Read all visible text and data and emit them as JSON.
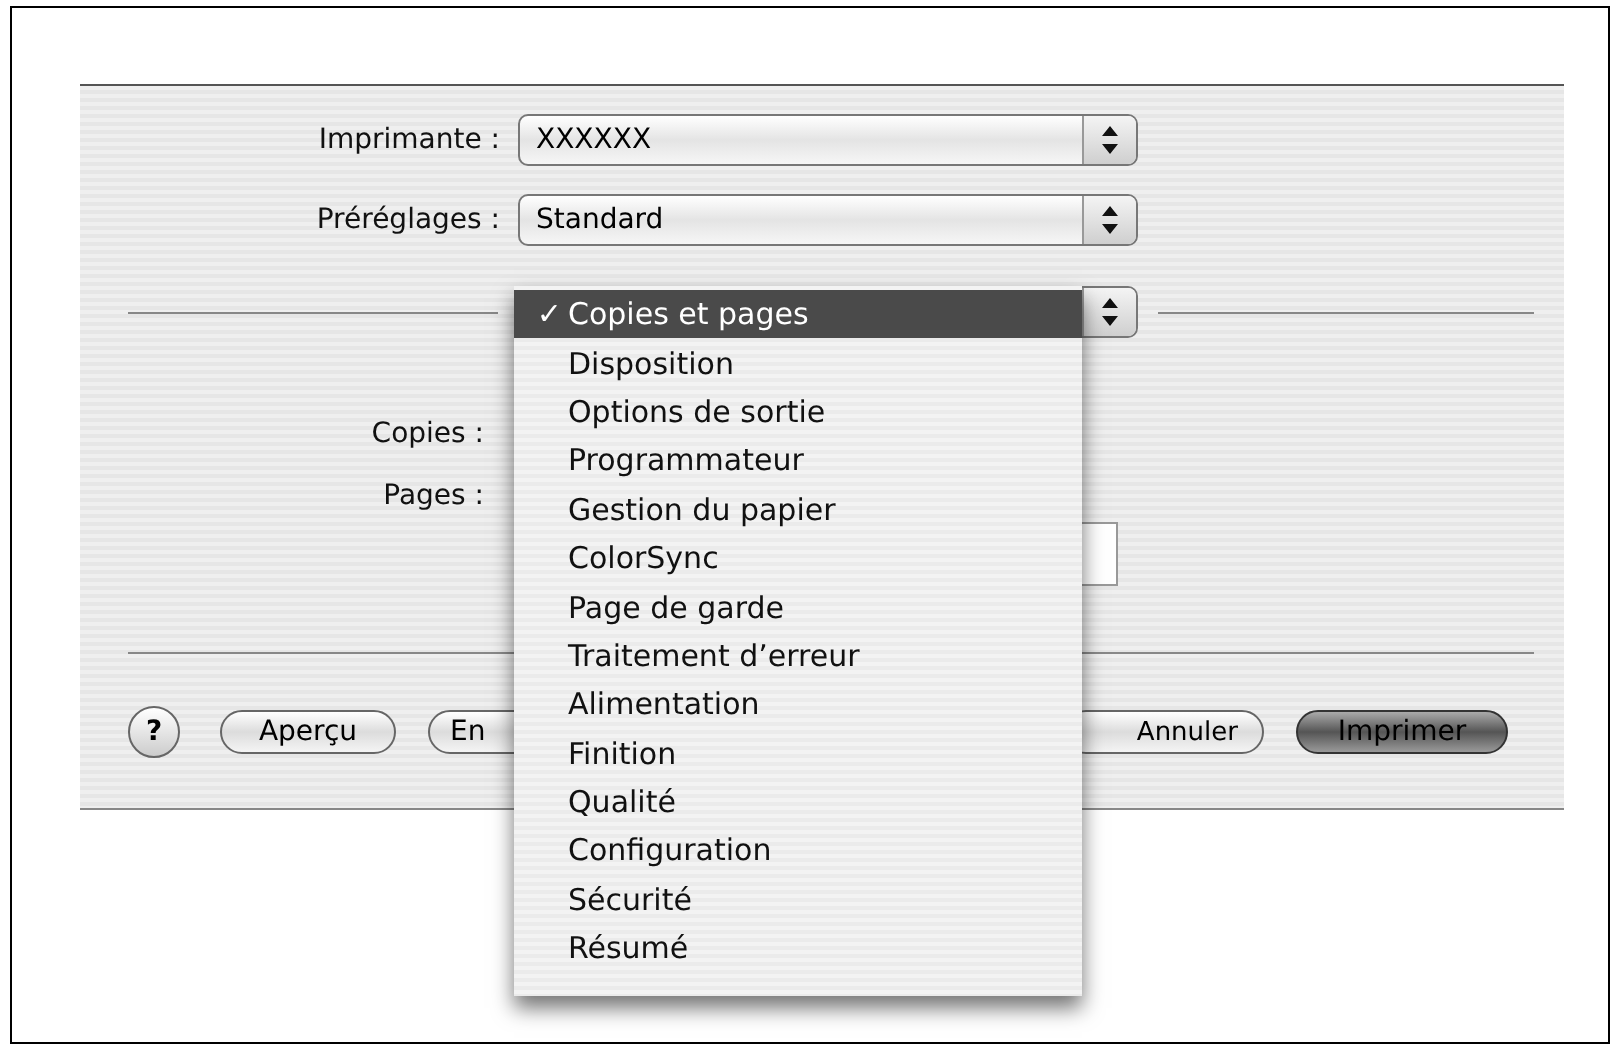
{
  "printer": {
    "label": "Imprimante :",
    "value": "XXXXXX"
  },
  "presets": {
    "label": "Préréglages :",
    "value": "Standard"
  },
  "copies": {
    "label": "Copies :"
  },
  "pages": {
    "label": "Pages :"
  },
  "help_button": "?",
  "buttons": [
    {
      "label": "Aperçu",
      "kind": "normal"
    },
    {
      "label": "En",
      "kind": "covered"
    },
    {
      "label": "Annuler",
      "kind": "normal"
    },
    {
      "label": "Imprimer",
      "kind": "default"
    }
  ],
  "menu": {
    "mark": "✓",
    "items": [
      {
        "label": "Copies et pages",
        "selected": true
      },
      {
        "label": "Disposition",
        "selected": false
      },
      {
        "label": "Options de sortie",
        "selected": false
      },
      {
        "label": "Programmateur",
        "selected": false
      },
      {
        "label": "Gestion du papier",
        "selected": false
      },
      {
        "label": "ColorSync",
        "selected": false
      },
      {
        "label": "Page de garde",
        "selected": false
      },
      {
        "label": "Traitement d’erreur",
        "selected": false
      },
      {
        "label": "Alimentation",
        "selected": false
      },
      {
        "label": "Finition",
        "selected": false
      },
      {
        "label": "Qualité",
        "selected": false
      },
      {
        "label": "Configuration",
        "selected": false
      },
      {
        "label": "Sécurité",
        "selected": false
      },
      {
        "label": "Résumé",
        "selected": false
      }
    ]
  }
}
